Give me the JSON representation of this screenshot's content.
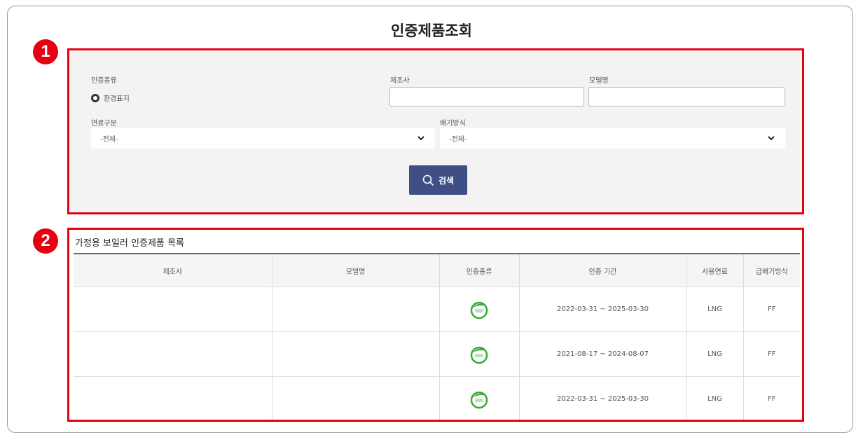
{
  "page": {
    "title": "인증제품조회"
  },
  "badges": [
    "1",
    "2"
  ],
  "search": {
    "cert_type_label": "인증종류",
    "cert_type_option": "환경표지",
    "maker_label": "제조사",
    "maker_value": "",
    "model_label": "모델명",
    "model_value": "",
    "fuel_label": "연료구분",
    "fuel_selected": "-전체-",
    "exhaust_label": "배기방식",
    "exhaust_selected": "-전체-",
    "button_label": "검색"
  },
  "list": {
    "title": "가정용 보일러 인증제품 목록",
    "columns": [
      "제조사",
      "모델명",
      "인증종류",
      "인증 기간",
      "사용연료",
      "급배기방식"
    ],
    "rows": [
      {
        "maker": "",
        "model": "",
        "cert_icon": "eco-label-icon",
        "period": "2022-03-31 ~ 2025-03-30",
        "fuel": "LNG",
        "exhaust": "FF"
      },
      {
        "maker": "",
        "model": "",
        "cert_icon": "eco-label-icon",
        "period": "2021-08-17 ~ 2024-08-07",
        "fuel": "LNG",
        "exhaust": "FF"
      },
      {
        "maker": "",
        "model": "",
        "cert_icon": "eco-label-icon",
        "period": "2022-03-31 ~ 2025-03-30",
        "fuel": "LNG",
        "exhaust": "FF"
      }
    ]
  },
  "colors": {
    "highlight": "#e50012",
    "button": "#3f4f86",
    "panel": "#f3f3f4",
    "eco_green": "#3aa935"
  }
}
